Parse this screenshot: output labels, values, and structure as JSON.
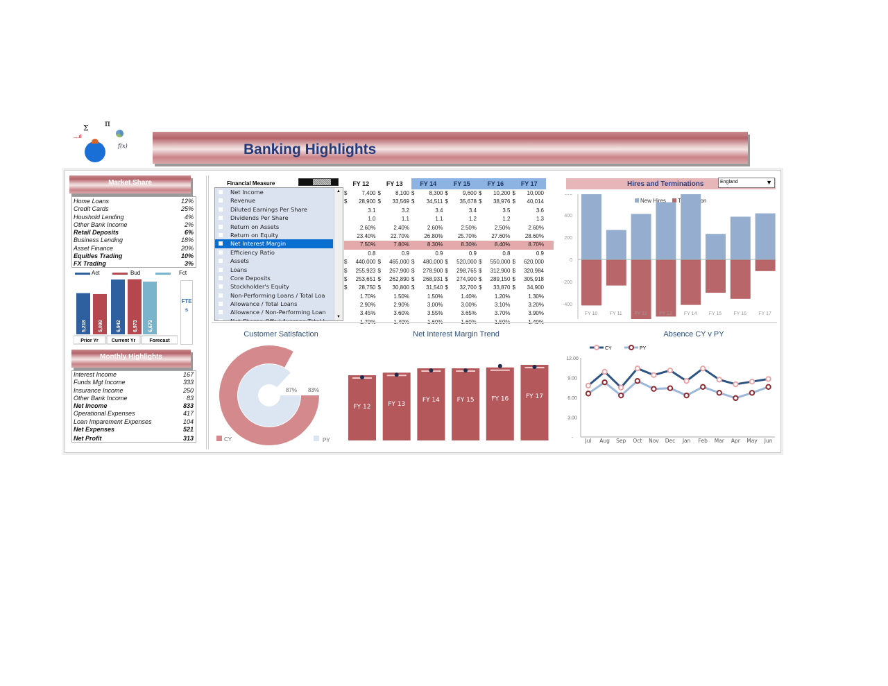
{
  "header": {
    "title": "Banking Highlights",
    "logo_symbols": [
      "Σ",
      "π",
      "f(x)"
    ]
  },
  "market_share": {
    "title": "Market Share",
    "items": [
      {
        "label": "Home Loans",
        "value": "12%",
        "bold": false
      },
      {
        "label": "Credit Cards",
        "value": "25%",
        "bold": false
      },
      {
        "label": "Houshold Lending",
        "value": "4%",
        "bold": false
      },
      {
        "label": "Other Bank Income",
        "value": "2%",
        "bold": false
      },
      {
        "label": "Retail Deposits",
        "value": "6%",
        "bold": true
      },
      {
        "label": "Business Lending",
        "value": "18%",
        "bold": false
      },
      {
        "label": "Asset Finance",
        "value": "20%",
        "bold": false
      },
      {
        "label": "Equities Trading",
        "value": "10%",
        "bold": true
      },
      {
        "label": "FX Trading",
        "value": "3%",
        "bold": true
      }
    ]
  },
  "fte": {
    "legend": [
      "Act",
      "Bud",
      "Fct"
    ],
    "side_label": "FTEs",
    "groups": [
      "Prior Yr",
      "Current Yr",
      "Forecast"
    ],
    "bars": [
      {
        "group": "Prior Yr",
        "series": "Act",
        "value": 5218,
        "label": "5,218"
      },
      {
        "group": "Prior Yr",
        "series": "Bud",
        "value": 5098,
        "label": "5,098"
      },
      {
        "group": "Current Yr",
        "series": "Act",
        "value": 6942,
        "label": "6,942"
      },
      {
        "group": "Current Yr",
        "series": "Bud",
        "value": 6973,
        "label": "6,973"
      },
      {
        "group": "Forecast",
        "series": "Fct",
        "value": 6673,
        "label": "6,673"
      }
    ],
    "colors": {
      "Act": "#2e5f9e",
      "Bud": "#b5484e",
      "Fct": "#79b4cc"
    }
  },
  "monthly": {
    "title": "Monthly Highlights",
    "items": [
      {
        "label": "Interest Income",
        "value": "167",
        "bold": false
      },
      {
        "label": "Funds Mgt Income",
        "value": "333",
        "bold": false
      },
      {
        "label": "Insurance Income",
        "value": "250",
        "bold": false
      },
      {
        "label": "Other Bank Income",
        "value": "83",
        "bold": false
      },
      {
        "label": "Net Income",
        "value": "833",
        "bold": true
      },
      {
        "label": "Operational Expenses",
        "value": "417",
        "bold": false
      },
      {
        "label": "Loan Imparement Expenses",
        "value": "104",
        "bold": false
      },
      {
        "label": "Net Expenses",
        "value": "521",
        "bold": true
      },
      {
        "label": "Net Profit",
        "value": "313",
        "bold": true
      }
    ]
  },
  "financial": {
    "header": "Financial Measure",
    "selected": "Net Interest Margin",
    "measures": [
      "Net Income",
      "Revenue",
      "Diluted Earnings Per Share",
      "Dividends Per Share",
      "Return on Assets",
      "Return on Equity",
      "Net Interest Margin",
      "Efficiency Ratio",
      "Assets",
      "Loans",
      "Core Deposits",
      "Stockholder's Equity",
      "Non-Performing Loans / Total Loa",
      "Allowance / Total Loans",
      "Allowance / Non-Performing Loan",
      "Net Charge-Offs / Average Total L"
    ],
    "years": [
      "FY 12",
      "FY 13",
      "FY 14",
      "FY 15",
      "FY 16",
      "FY 17"
    ],
    "rows": [
      {
        "cur": true,
        "v": [
          "7,400",
          "8,100",
          "8,300",
          "9,600",
          "10,200",
          "10,000"
        ]
      },
      {
        "cur": true,
        "v": [
          "28,900",
          "33,569",
          "34,511",
          "35,678",
          "38,976",
          "40,014"
        ]
      },
      {
        "cur": false,
        "v": [
          "3.1",
          "3.2",
          "3.4",
          "3.4",
          "3.5",
          "3.6"
        ]
      },
      {
        "cur": false,
        "v": [
          "1.0",
          "1.1",
          "1.1",
          "1.2",
          "1.2",
          "1.3"
        ]
      },
      {
        "cur": false,
        "v": [
          "2.60%",
          "2.40%",
          "2.60%",
          "2.50%",
          "2.50%",
          "2.60%"
        ]
      },
      {
        "cur": false,
        "v": [
          "23.40%",
          "22.70%",
          "26.80%",
          "25.70%",
          "27.60%",
          "28.60%"
        ]
      },
      {
        "cur": false,
        "hl": true,
        "v": [
          "7.50%",
          "7.80%",
          "8.30%",
          "8.30%",
          "8.40%",
          "8.70%"
        ]
      },
      {
        "cur": false,
        "v": [
          "0.8",
          "0.9",
          "0.9",
          "0.9",
          "0.8",
          "0.9"
        ]
      },
      {
        "cur": true,
        "v": [
          "440,000",
          "465,000",
          "480,000",
          "520,000",
          "550,000",
          "620,000"
        ]
      },
      {
        "cur": true,
        "v": [
          "255,923",
          "267,900",
          "278,900",
          "298,765",
          "312,900",
          "320,984"
        ]
      },
      {
        "cur": true,
        "v": [
          "253,651",
          "262,890",
          "268,931",
          "274,900",
          "289,150",
          "305,918"
        ]
      },
      {
        "cur": true,
        "v": [
          "28,750",
          "30,800",
          "31,540",
          "32,700",
          "33,870",
          "34,900"
        ]
      },
      {
        "cur": false,
        "v": [
          "1.70%",
          "1.50%",
          "1.50%",
          "1.40%",
          "1.20%",
          "1.30%"
        ]
      },
      {
        "cur": false,
        "v": [
          "2.90%",
          "2.90%",
          "3.00%",
          "3.00%",
          "3.10%",
          "3.20%"
        ]
      },
      {
        "cur": false,
        "v": [
          "3.45%",
          "3.60%",
          "3.55%",
          "3.65%",
          "3.70%",
          "3.90%"
        ]
      },
      {
        "cur": false,
        "v": [
          "1.70%",
          "1.40%",
          "1.60%",
          "1.60%",
          "1.50%",
          "1.40%"
        ]
      }
    ],
    "currency": "$"
  },
  "hires": {
    "title": "Hires and Terminations",
    "region_select": "England"
  },
  "chart_data": [
    {
      "type": "bar",
      "id": "hires",
      "title": "Hires and Terminations",
      "categories": [
        "FY 10",
        "FY 11",
        "FY 12",
        "FY 13",
        "FY 14",
        "FY 15",
        "FY 16",
        "FY 17"
      ],
      "series": [
        {
          "name": "New Hires",
          "values": [
            600,
            265,
            410,
            515,
            610,
            230,
            385,
            415
          ],
          "color": "#95aed0"
        },
        {
          "name": "Termination",
          "values": [
            -415,
            -235,
            -615,
            -515,
            -410,
            -300,
            -355,
            -105
          ],
          "color": "#b86669"
        }
      ],
      "ylim": [
        -800,
        800
      ],
      "yticks": [
        "-800",
        "-600",
        "-400",
        "-200",
        "0",
        "200",
        "400",
        "600",
        "800"
      ],
      "legend": "top",
      "stacked": true
    },
    {
      "type": "pie",
      "id": "satisfaction",
      "title": "Customer Satisfaction",
      "subtype": "doughnut",
      "series": [
        {
          "name": "CY",
          "value": 83,
          "label": "83%",
          "color": "#d48a8d"
        },
        {
          "name": "PY",
          "value": 87,
          "label": "87%",
          "color": "#dce6f2"
        }
      ],
      "legend": "bottom"
    },
    {
      "type": "bar",
      "id": "nim",
      "title": "Net Interest Margin Trend",
      "categories": [
        "FY 12",
        "FY 13",
        "FY 14",
        "FY 15",
        "FY 16",
        "FY 17"
      ],
      "values": [
        7.5,
        7.8,
        8.3,
        8.3,
        8.4,
        8.7
      ],
      "color": "#b5585c",
      "marker_color": "#1f2d4a"
    },
    {
      "type": "line",
      "id": "absence",
      "title": "Absence CY v PY",
      "categories": [
        "Jul",
        "Aug",
        "Sep",
        "Oct",
        "Nov",
        "Dec",
        "Jan",
        "Feb",
        "Mar",
        "Apr",
        "May",
        "Jun"
      ],
      "series": [
        {
          "name": "CY",
          "values": [
            7.8,
            9.9,
            7.5,
            10.4,
            9.4,
            10.1,
            8.5,
            10.4,
            8.7,
            8.0,
            8.4,
            8.8
          ],
          "color": "#2e5484",
          "marker": "#e8a6a8"
        },
        {
          "name": "PY",
          "values": [
            6.6,
            8.3,
            6.3,
            8.5,
            7.3,
            7.4,
            6.3,
            7.6,
            6.7,
            5.9,
            6.7,
            7.6
          ],
          "color": "#9db7d8",
          "marker": "#8e2a30"
        }
      ],
      "ylim": [
        0,
        12
      ],
      "yticks": [
        "-",
        "3.00",
        "6.00",
        "9.00",
        "12.00"
      ],
      "legend": "top-left"
    }
  ]
}
